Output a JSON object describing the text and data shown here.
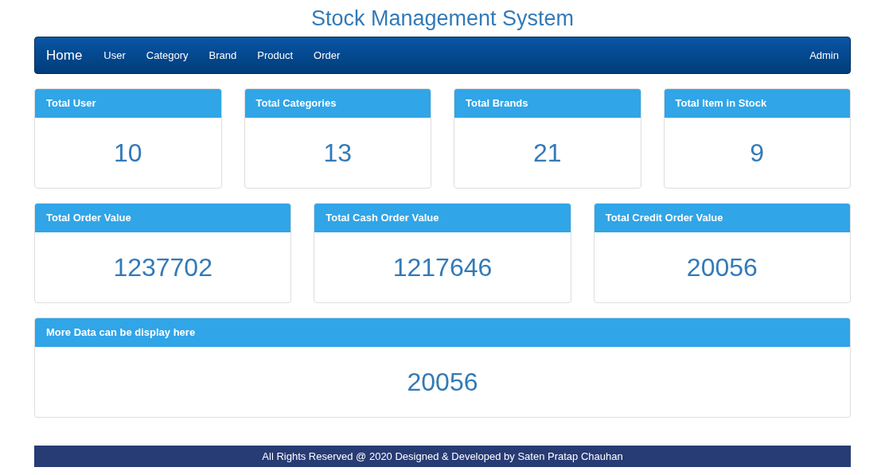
{
  "title": "Stock Management System",
  "navbar": {
    "brand": "Home",
    "items": [
      "User",
      "Category",
      "Brand",
      "Product",
      "Order"
    ],
    "right": "Admin"
  },
  "stat_rows": [
    [
      {
        "label": "Total User",
        "value": "10"
      },
      {
        "label": "Total Categories",
        "value": "13"
      },
      {
        "label": "Total Brands",
        "value": "21"
      },
      {
        "label": "Total Item in Stock",
        "value": "9"
      }
    ],
    [
      {
        "label": "Total Order Value",
        "value": "1237702"
      },
      {
        "label": "Total Cash Order Value",
        "value": "1217646"
      },
      {
        "label": "Total Credit Order Value",
        "value": "20056"
      }
    ],
    [
      {
        "label": "More Data can be display here",
        "value": "20056"
      }
    ]
  ],
  "footer": "All Rights Reserved @ 2020 Designed & Developed by Saten Pratap Chauhan"
}
